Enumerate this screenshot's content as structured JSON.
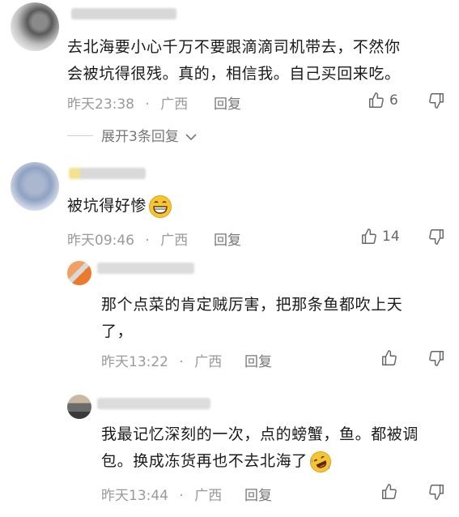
{
  "comments": [
    {
      "text_line1": "去北海要小心千万不要跟滴滴司机带去，不然你",
      "text_line2": "会被坑得很残。真的，相信我。自己买回来吃。",
      "time": "昨天23:38",
      "region": "广西",
      "reply_label": "回复",
      "likes": "6",
      "expand_label": "展开3条回复"
    },
    {
      "text": "被坑得好惨",
      "emoji": "grinning-emoji",
      "time": "昨天09:46",
      "region": "广西",
      "reply_label": "回复",
      "likes": "14"
    }
  ],
  "replies": [
    {
      "text_line1": "那个点菜的肯定贼厉害，把那条鱼都吹上天",
      "text_line2": "了，",
      "time": "昨天13:22",
      "region": "广西",
      "reply_label": "回复"
    },
    {
      "text_line1": "我最记忆深刻的一次，点的螃蟹，鱼。都被调",
      "text_line2": "包。换成冻货再也不去北海了",
      "emoji": "rofl-emoji",
      "time": "昨天13:44",
      "region": "广西",
      "reply_label": "回复"
    }
  ],
  "separator": "·",
  "colors": {
    "meta": "#9a9a9a",
    "text": "#1a1a1a",
    "emoji": "#f7c531"
  }
}
